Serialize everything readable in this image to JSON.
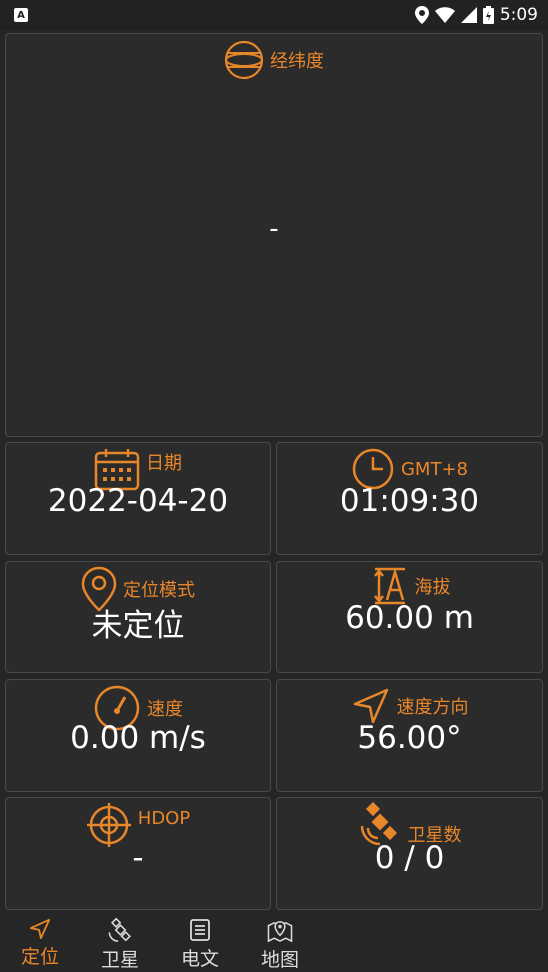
{
  "status": {
    "time": "5:09"
  },
  "cards": {
    "latlon": {
      "label": "经纬度",
      "value": "-"
    },
    "date": {
      "label": "日期",
      "value": "2022-04-20"
    },
    "time": {
      "label": "GMT+8",
      "value": "01:09:30"
    },
    "mode": {
      "label": "定位模式",
      "value": "未定位"
    },
    "altitude": {
      "label": "海拔",
      "value": "60.00 m"
    },
    "speed": {
      "label": "速度",
      "value": "0.00 m/s"
    },
    "heading": {
      "label": "速度方向",
      "value": "56.00°"
    },
    "hdop": {
      "label": "HDOP",
      "value": "-"
    },
    "satellites": {
      "label": "卫星数",
      "value": "0 / 0"
    }
  },
  "nav": [
    {
      "label": "定位",
      "icon": "navigation-arrow-icon",
      "active": true
    },
    {
      "label": "卫星",
      "icon": "satellite-icon"
    },
    {
      "label": "电文",
      "icon": "document-icon"
    },
    {
      "label": "地图",
      "icon": "map-pin-icon"
    }
  ],
  "colors": {
    "accent": "#e8862a",
    "background": "#262626",
    "card": "#2b2b2b",
    "border": "#4a4a4a"
  }
}
